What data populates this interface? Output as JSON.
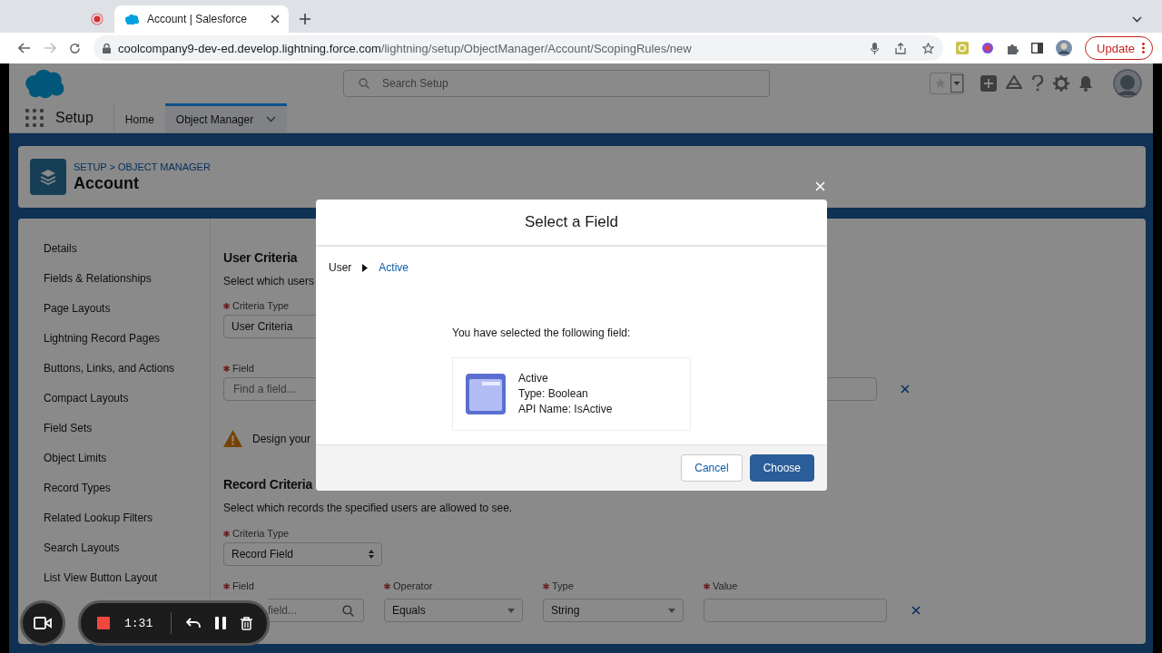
{
  "browser": {
    "tabs": [
      {
        "title": "Account | Salesforce",
        "selected": true
      }
    ],
    "url_host": "coolcompany9-dev-ed.develop.lightning.force.com",
    "url_path": "/lightning/setup/ObjectManager/Account/ScopingRules/new",
    "update_button": "Update"
  },
  "header": {
    "search_placeholder": "Search Setup"
  },
  "nav": {
    "app_name": "Setup",
    "items": [
      {
        "label": "Home",
        "selected": false
      },
      {
        "label": "Object Manager",
        "selected": true
      }
    ]
  },
  "page_header": {
    "breadcrumb": "SETUP > OBJECT MANAGER",
    "title": "Account"
  },
  "sidebar": {
    "items": [
      {
        "label": "Details",
        "selected": false
      },
      {
        "label": "Fields & Relationships",
        "selected": false
      },
      {
        "label": "Page Layouts",
        "selected": false
      },
      {
        "label": "Lightning Record Pages",
        "selected": false
      },
      {
        "label": "Buttons, Links, and Actions",
        "selected": false
      },
      {
        "label": "Compact Layouts",
        "selected": false
      },
      {
        "label": "Field Sets",
        "selected": false
      },
      {
        "label": "Object Limits",
        "selected": false
      },
      {
        "label": "Record Types",
        "selected": false
      },
      {
        "label": "Related Lookup Filters",
        "selected": false
      },
      {
        "label": "Search Layouts",
        "selected": false
      },
      {
        "label": "List View Button Layout",
        "selected": false
      }
    ]
  },
  "user_criteria": {
    "title": "User Criteria",
    "description": "Select which users",
    "criteria_type": {
      "label": "Criteria Type",
      "required": true,
      "value": "User Criteria"
    },
    "field": {
      "label": "Field",
      "required": true,
      "placeholder": "Find a field..."
    },
    "warning": "Design your"
  },
  "record_criteria": {
    "title": "Record Criteria",
    "description": "Select which records the specified users are allowed to see.",
    "criteria_type": {
      "label": "Criteria Type",
      "required": true,
      "value": "Record Field"
    },
    "columns": [
      {
        "label": "Field",
        "required": true,
        "kind": "search",
        "placeholder": "field..."
      },
      {
        "label": "Operator",
        "required": true,
        "kind": "select",
        "value": "Equals"
      },
      {
        "label": "Type",
        "required": true,
        "kind": "select",
        "value": "String"
      },
      {
        "label": "Value",
        "required": true,
        "kind": "text"
      }
    ]
  },
  "modal": {
    "title": "Select a Field",
    "path": [
      "User",
      "Active"
    ],
    "message": "You have selected the following field:",
    "field": {
      "name": "Active",
      "type": "Type: Boolean",
      "api_name": "API Name: IsActive"
    },
    "buttons": [
      {
        "label": "Cancel",
        "kind": "neutral"
      },
      {
        "label": "Choose",
        "kind": "brand"
      }
    ]
  },
  "recorder": {
    "time": "1:31"
  }
}
